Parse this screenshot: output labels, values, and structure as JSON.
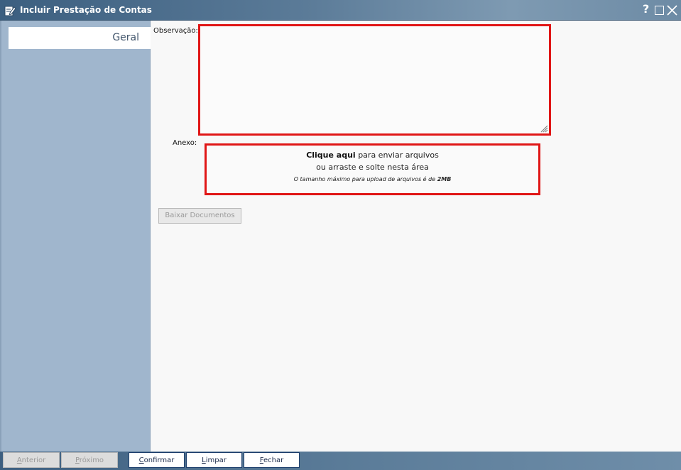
{
  "window": {
    "title": "Incluir Prestação de Contas",
    "icons": {
      "app": "edit-note-icon",
      "help": "help-icon",
      "maximize": "maximize-icon",
      "close": "close-icon"
    },
    "help_glyph": "?"
  },
  "sidebar": {
    "tabs": [
      {
        "label": "Geral",
        "selected": true
      }
    ]
  },
  "form": {
    "observacao_label": "Observação:",
    "observacao_value": "",
    "anexo_label": "Anexo:",
    "upload": {
      "click_text": "Clique aqui",
      "line1_rest": " para enviar arquivos",
      "line2": "ou arraste e solte nesta área",
      "limit_prefix": "O tamanho máximo para upload de arquivos é de ",
      "limit_value": "2MB"
    },
    "download_button": "Baixar Documentos"
  },
  "footer": {
    "prev": {
      "first": "A",
      "rest": "nterior"
    },
    "next": {
      "first": "P",
      "rest": "róximo"
    },
    "confirm": {
      "first": "C",
      "rest": "onfirmar"
    },
    "clear": {
      "first": "L",
      "rest": "impar"
    },
    "close": {
      "first": "F",
      "rest": "echar"
    }
  },
  "colors": {
    "highlight_border": "#e01616",
    "titlebar": "#3c5f80",
    "sidebar": "#a0b6cd"
  }
}
